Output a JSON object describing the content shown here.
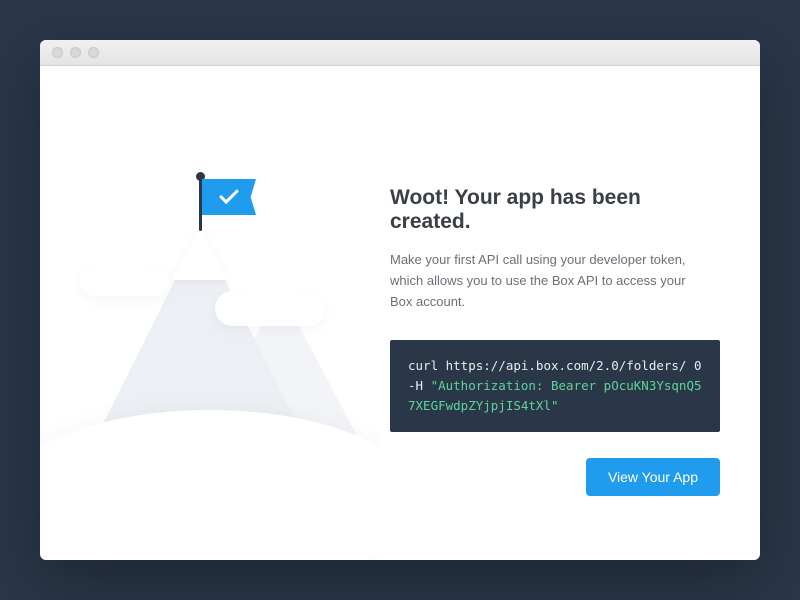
{
  "heading": "Woot! Your app has been created.",
  "subtext": "Make your first API call using your developer token, which allows you to use the Box API to access your Box account.",
  "code": {
    "line1": "curl https://api.box.com/2.0/folders/ 0",
    "line2_prefix": "-H ",
    "line2_string": "\"Authorization: Bearer pOcuKN3YsqnQ57XEGFwdpZYjpjIS4tXl\""
  },
  "cta_label": "View Your App"
}
